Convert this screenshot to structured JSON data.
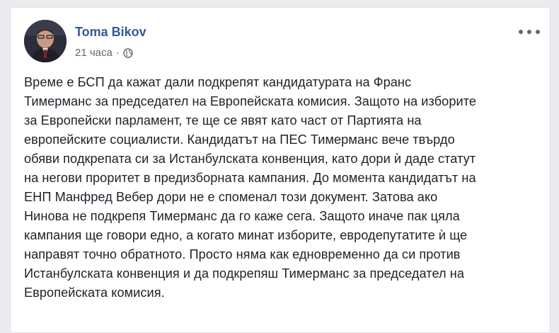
{
  "post": {
    "author": "Toma Bikov",
    "time": "21 часа",
    "separator": "·",
    "privacy_icon": "globe-icon",
    "more_icon": "more-options-icon",
    "text_lines": [
      "Време е БСП да кажат дали подкрепят кандидатурата на Франс",
      "Тимерманс за председател на Европейската комисия. Защото на изборите",
      "за Европейски парламент, те ще се явят като част от Партията на",
      "европейските социалисти. Кандидатът на ПЕС Тимерманс вече твърдо",
      "обяви подкрепата си за Истанбулската конвенция, като дори ѝ даде статут",
      "на негови проритет в предизборната кампания. До момента кандидатът на",
      "ЕНП Манфред Вебер дори не е споменал този документ. Затова ако",
      "Нинова не подкрепя Тимерманс да го каже сега. Защото иначе пак цяла",
      "кампания ще говори едно, а когато минат изборите, евродепутатите ѝ ще",
      "направят точно обратното. Просто няма как едновременно да си против",
      "Истанбулската конвенция и да подкрепяш Тимерманс за председател на",
      "Европейската комисия."
    ]
  },
  "colors": {
    "author_link": "#365899",
    "body_text": "#1d2129",
    "meta_text": "#616770",
    "page_bg": "#e9ebee"
  }
}
